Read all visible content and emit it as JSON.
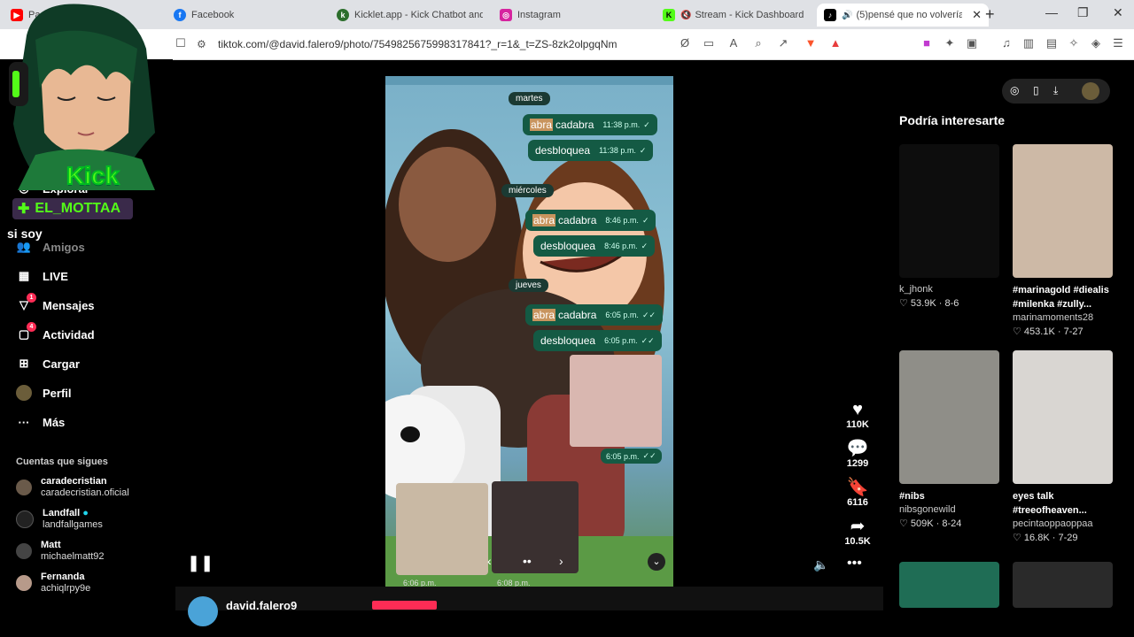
{
  "browser": {
    "tabs": [
      {
        "label": "Pa...   ...be",
        "icon": "youtube-icon",
        "color": "#ff0000"
      },
      {
        "label": "Facebook",
        "icon": "facebook-icon",
        "color": "#1877f2"
      },
      {
        "label": "Kicklet.app - Kick Chatbot and C",
        "icon": "kicklet-icon",
        "color": "#2c6e2c"
      },
      {
        "label": "Instagram",
        "icon": "instagram-icon",
        "color": "#d6249f"
      },
      {
        "label": "Stream - Kick Dashboard",
        "icon": "kick-icon",
        "color": "#53fc18"
      },
      {
        "label": "(5)pensé que no volvería",
        "icon": "tiktok-icon",
        "color": "#000000",
        "active": true
      }
    ],
    "url": "tiktok.com/@david.falero9/photo/7549825675998317841?_r=1&_t=ZS-8zk2olpgqNm"
  },
  "overlay": {
    "kick_label": "Kick",
    "username": "EL_MOTTAA",
    "caption": "si soy"
  },
  "sidebar": {
    "items": [
      {
        "label": "Explorar",
        "icon": "compass-icon"
      },
      {
        "label": "Amigos",
        "icon": "friends-icon"
      },
      {
        "label": "LIVE",
        "icon": "live-icon"
      },
      {
        "label": "Mensajes",
        "icon": "messages-icon",
        "badge": "1"
      },
      {
        "label": "Actividad",
        "icon": "activity-icon",
        "badge": "4"
      },
      {
        "label": "Cargar",
        "icon": "upload-icon"
      },
      {
        "label": "Perfil",
        "icon": "profile-icon"
      },
      {
        "label": "Más",
        "icon": "more-icon"
      }
    ],
    "following_title": "Cuentas que sigues",
    "following": [
      {
        "name": "caradecristian",
        "handle": "caradecristian.oficial"
      },
      {
        "name": "Landfall",
        "handle": "landfallgames",
        "verified": true
      },
      {
        "name": "Matt",
        "handle": "michaelmatt92"
      },
      {
        "name": "Fernanda",
        "handle": "achiqlrpy9e"
      }
    ]
  },
  "video": {
    "days": [
      "martes",
      "miércoles",
      "jueves"
    ],
    "messages": [
      {
        "hl": "abra",
        "text": "cadabra",
        "time": "11:38 p.m."
      },
      {
        "hl": "",
        "text": "desbloquea",
        "time": "11:38 p.m."
      },
      {
        "hl": "abra",
        "text": "cadabra",
        "time": "8:46 p.m."
      },
      {
        "hl": "",
        "text": "desbloquea",
        "time": "8:46 p.m."
      },
      {
        "hl": "abra",
        "text": "cadabra",
        "time": "6:05 p.m."
      },
      {
        "hl": "",
        "text": "desbloquea",
        "time": "6:05 p.m."
      }
    ],
    "image_time": "6:05 p.m.",
    "bottom_times": [
      "6:06 p.m.",
      "6:08 p.m."
    ]
  },
  "actions": {
    "likes": "110K",
    "comments": "1299",
    "saves": "6116",
    "shares": "10.5K"
  },
  "author": {
    "name": "david.falero9"
  },
  "recommend": {
    "title": "Podría interesarte",
    "cards": [
      {
        "caption": "",
        "author": "k_jhonk",
        "likes": "53.9K",
        "date": "8-6",
        "color": "#0d0d0d"
      },
      {
        "caption": "#marinagold #diealis #milenka #zully...",
        "author": "marinamoments28",
        "likes": "453.1K",
        "date": "7-27",
        "color": "#cdb9a6"
      },
      {
        "caption": "#nibs",
        "author": "nibsgonewild",
        "likes": "509K",
        "date": "8-24",
        "color": "#8f8e88"
      },
      {
        "caption": "eyes talk #treeofheaven...",
        "author": "pecintaoppaoppaa",
        "likes": "16.8K",
        "date": "7-29",
        "color": "#d9d6d2"
      },
      {
        "caption": "",
        "author": "",
        "likes": "",
        "date": "",
        "color": "#1f6d55"
      },
      {
        "caption": "",
        "author": "",
        "likes": "",
        "date": "",
        "color": "#2a2a2a"
      }
    ]
  }
}
